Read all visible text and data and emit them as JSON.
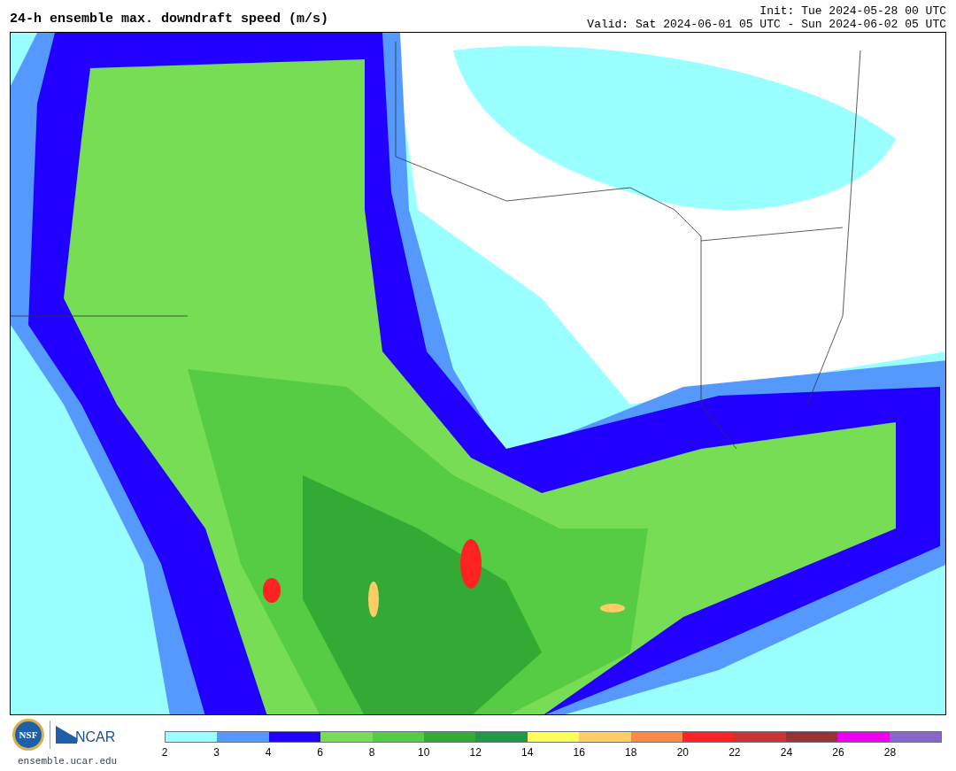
{
  "title": "24-h ensemble max. downdraft speed (m/s)",
  "init": "Init: Tue 2024-05-28 00 UTC",
  "valid": "Valid: Sat 2024-06-01 05 UTC - Sun 2024-06-02 05 UTC",
  "logos": {
    "nsf": "NSF",
    "ncar": "NCAR",
    "site": "ensemble.ucar.edu"
  },
  "colorbar": {
    "bins": [
      {
        "color": "#99ffff"
      },
      {
        "color": "#5599ff"
      },
      {
        "color": "#2200ff"
      },
      {
        "color": "#77dd55"
      },
      {
        "color": "#55cc44"
      },
      {
        "color": "#33aa33"
      },
      {
        "color": "#229944"
      },
      {
        "color": "#ffff55"
      },
      {
        "color": "#ffcc66"
      },
      {
        "color": "#ff8844"
      },
      {
        "color": "#ff2222"
      },
      {
        "color": "#cc3333"
      },
      {
        "color": "#993333"
      },
      {
        "color": "#ee00ee"
      },
      {
        "color": "#8866cc"
      }
    ],
    "ticks": [
      "2",
      "3",
      "4",
      "6",
      "8",
      "10",
      "12",
      "14",
      "16",
      "18",
      "20",
      "22",
      "24",
      "26",
      "28"
    ]
  }
}
